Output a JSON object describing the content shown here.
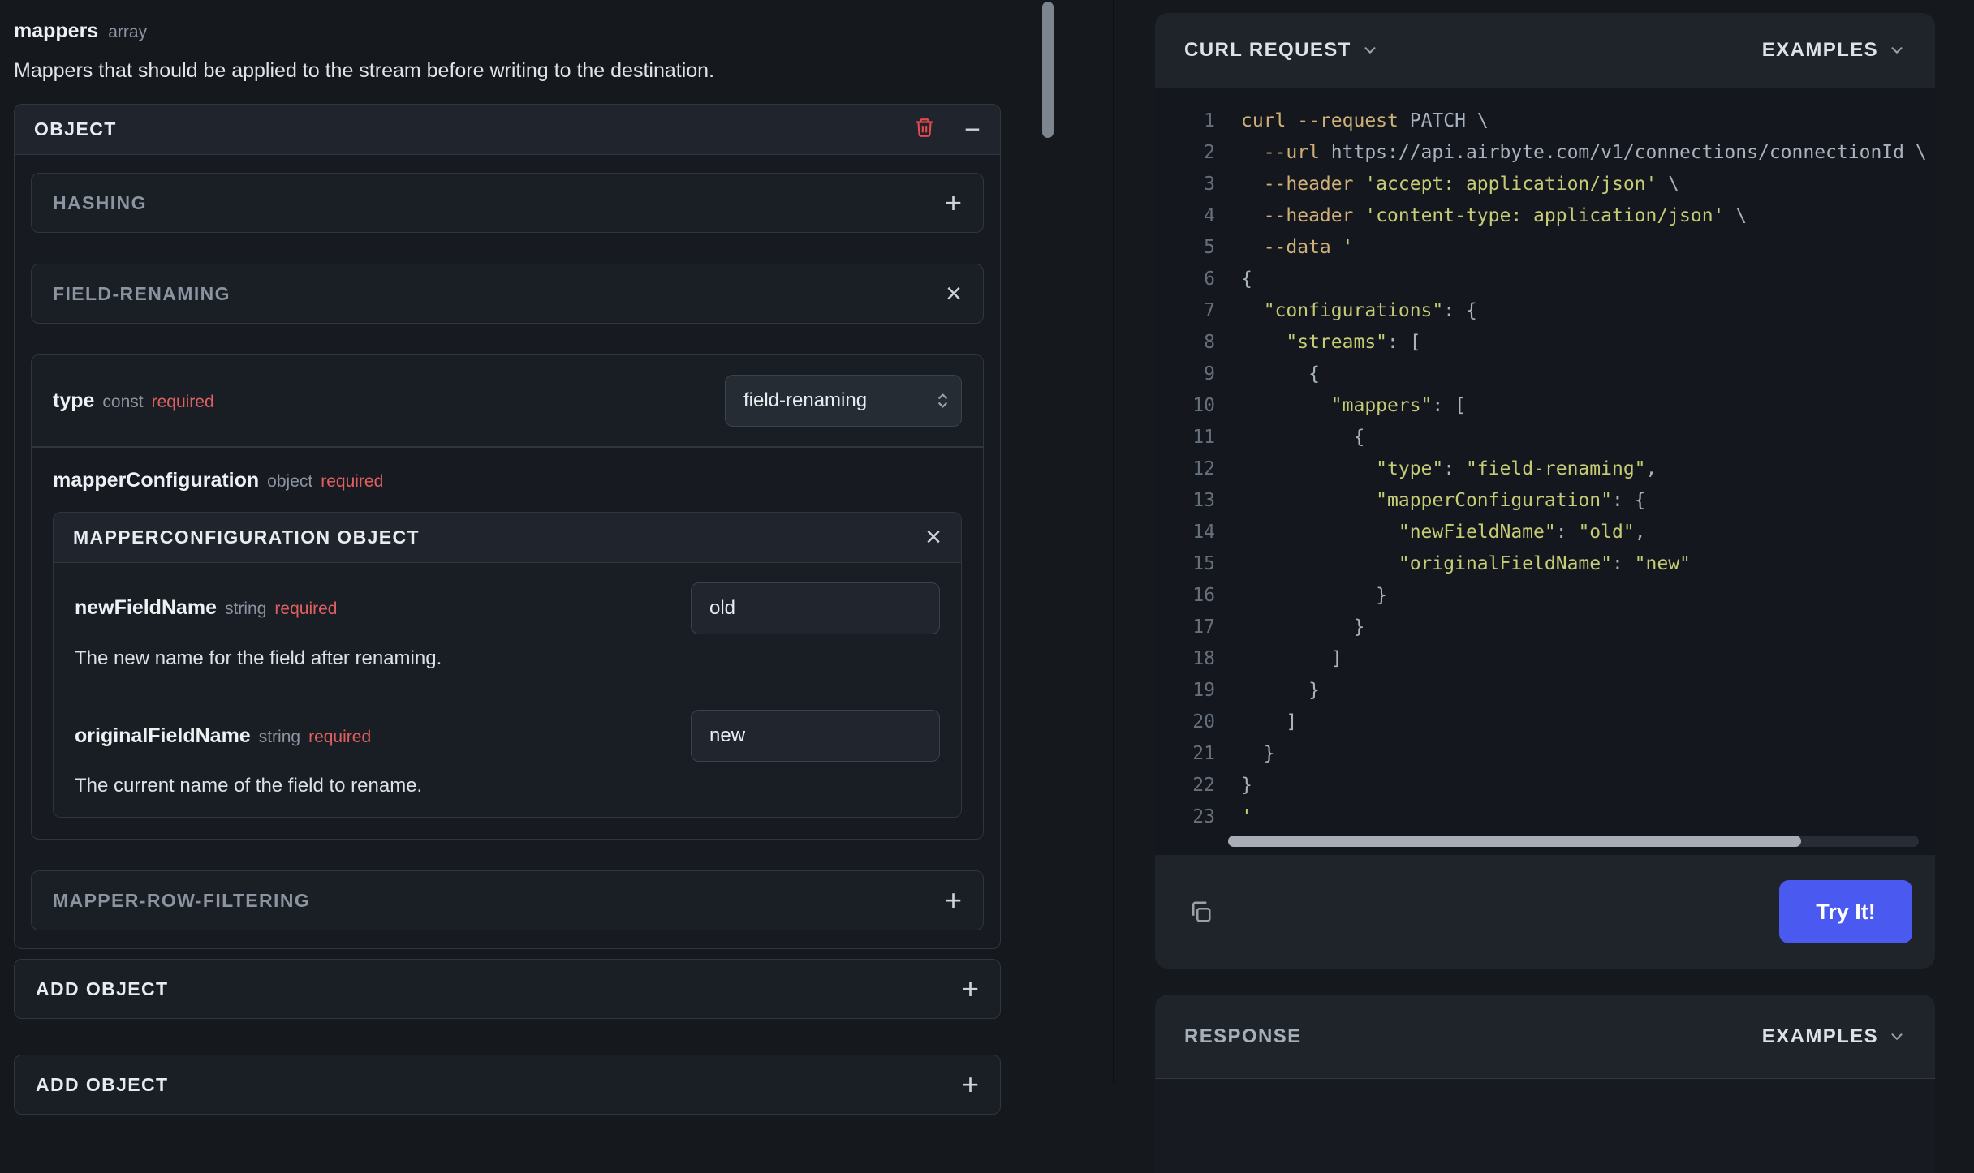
{
  "colors": {
    "accent_blue": "#4a5af0",
    "required_red": "#e06060",
    "danger_red": "#e5484d",
    "token_cmd": "#d0b077",
    "token_str": "#c6cc76",
    "token_pln": "#a9b2bd",
    "line_number": "#66707d"
  },
  "icons": {
    "minus": "−",
    "plus": "+",
    "close": "×"
  },
  "left_panel": {
    "field": {
      "name": "mappers",
      "type": "array"
    },
    "description": "Mappers that should be applied to the stream before writing to the destination.",
    "object_panel": {
      "title": "OBJECT",
      "hashing": {
        "title": "HASHING"
      },
      "field_renaming": {
        "title": "FIELD-RENAMING",
        "type_field": {
          "name": "type",
          "kind": "const",
          "required": "required",
          "value": "field-renaming"
        },
        "mapper_configuration": {
          "name": "mapperConfiguration",
          "kind": "object",
          "required": "required",
          "panel": {
            "title": "MAPPERCONFIGURATION OBJECT",
            "fields": [
              {
                "name": "newFieldName",
                "kind": "string",
                "required": "required",
                "value": "old",
                "description": "The new name for the field after renaming."
              },
              {
                "name": "originalFieldName",
                "kind": "string",
                "required": "required",
                "value": "new",
                "description": "The current name of the field to rename."
              }
            ]
          }
        }
      },
      "mapper_row_filtering": {
        "title": "MAPPER-ROW-FILTERING"
      }
    },
    "add_object_inner": {
      "label": "ADD OBJECT"
    },
    "add_object_outer": {
      "label": "ADD OBJECT"
    }
  },
  "request_panel": {
    "title": "CURL REQUEST",
    "examples_label": "EXAMPLES",
    "try_it_label": "Try It!",
    "code_lines": [
      {
        "n": 1,
        "parts": [
          {
            "c": "cmd",
            "t": "curl "
          },
          {
            "c": "cmd",
            "t": "--request "
          },
          {
            "c": "pln",
            "t": "PATCH \\"
          }
        ]
      },
      {
        "n": 2,
        "parts": [
          {
            "c": "cmd",
            "t": "  --url "
          },
          {
            "c": "pln",
            "t": "https://api.airbyte.com/v1/connections/connectionId \\"
          }
        ]
      },
      {
        "n": 3,
        "parts": [
          {
            "c": "cmd",
            "t": "  --header "
          },
          {
            "c": "str",
            "t": "'accept: application/json'"
          },
          {
            "c": "pln",
            "t": " \\"
          }
        ]
      },
      {
        "n": 4,
        "parts": [
          {
            "c": "cmd",
            "t": "  --header "
          },
          {
            "c": "str",
            "t": "'content-type: application/json'"
          },
          {
            "c": "pln",
            "t": " \\"
          }
        ]
      },
      {
        "n": 5,
        "parts": [
          {
            "c": "cmd",
            "t": "  --data "
          },
          {
            "c": "str",
            "t": "'"
          }
        ]
      },
      {
        "n": 6,
        "parts": [
          {
            "c": "pln",
            "t": "{"
          }
        ]
      },
      {
        "n": 7,
        "parts": [
          {
            "c": "str",
            "t": "  \"configurations\""
          },
          {
            "c": "pln",
            "t": ": {"
          }
        ]
      },
      {
        "n": 8,
        "parts": [
          {
            "c": "str",
            "t": "    \"streams\""
          },
          {
            "c": "pln",
            "t": ": ["
          }
        ]
      },
      {
        "n": 9,
        "parts": [
          {
            "c": "pln",
            "t": "      {"
          }
        ]
      },
      {
        "n": 10,
        "parts": [
          {
            "c": "str",
            "t": "        \"mappers\""
          },
          {
            "c": "pln",
            "t": ": ["
          }
        ]
      },
      {
        "n": 11,
        "parts": [
          {
            "c": "pln",
            "t": "          {"
          }
        ]
      },
      {
        "n": 12,
        "parts": [
          {
            "c": "str",
            "t": "            \"type\""
          },
          {
            "c": "pln",
            "t": ": "
          },
          {
            "c": "str",
            "t": "\"field-renaming\""
          },
          {
            "c": "pln",
            "t": ","
          }
        ]
      },
      {
        "n": 13,
        "parts": [
          {
            "c": "str",
            "t": "            \"mapperConfiguration\""
          },
          {
            "c": "pln",
            "t": ": {"
          }
        ]
      },
      {
        "n": 14,
        "parts": [
          {
            "c": "str",
            "t": "              \"newFieldName\""
          },
          {
            "c": "pln",
            "t": ": "
          },
          {
            "c": "str",
            "t": "\"old\""
          },
          {
            "c": "pln",
            "t": ","
          }
        ]
      },
      {
        "n": 15,
        "parts": [
          {
            "c": "str",
            "t": "              \"originalFieldName\""
          },
          {
            "c": "pln",
            "t": ": "
          },
          {
            "c": "str",
            "t": "\"new\""
          }
        ]
      },
      {
        "n": 16,
        "parts": [
          {
            "c": "pln",
            "t": "            }"
          }
        ]
      },
      {
        "n": 17,
        "parts": [
          {
            "c": "pln",
            "t": "          }"
          }
        ]
      },
      {
        "n": 18,
        "parts": [
          {
            "c": "pln",
            "t": "        ]"
          }
        ]
      },
      {
        "n": 19,
        "parts": [
          {
            "c": "pln",
            "t": "      }"
          }
        ]
      },
      {
        "n": 20,
        "parts": [
          {
            "c": "pln",
            "t": "    ]"
          }
        ]
      },
      {
        "n": 21,
        "parts": [
          {
            "c": "pln",
            "t": "  }"
          }
        ]
      },
      {
        "n": 22,
        "parts": [
          {
            "c": "pln",
            "t": "}"
          }
        ]
      },
      {
        "n": 23,
        "parts": [
          {
            "c": "str",
            "t": "'"
          }
        ]
      }
    ]
  },
  "response_panel": {
    "title": "RESPONSE",
    "examples_label": "EXAMPLES"
  }
}
